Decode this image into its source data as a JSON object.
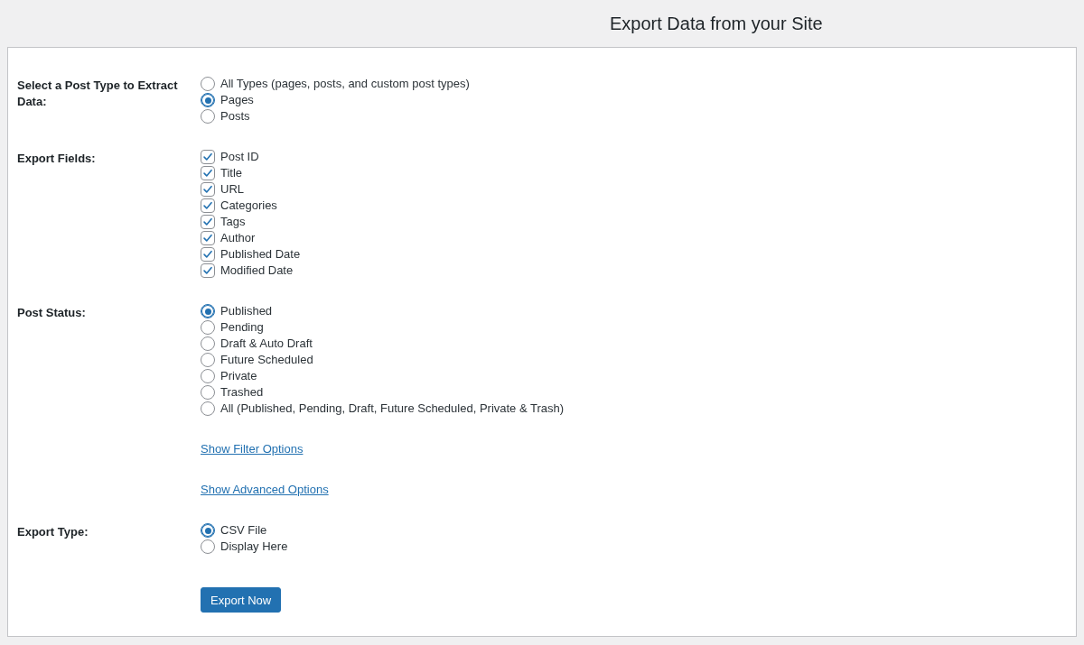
{
  "page": {
    "title": "Export Data from your Site"
  },
  "sections": [
    {
      "kind": "radio",
      "label": "Select a Post Type to Extract Data:",
      "options": [
        {
          "label": "All Types (pages, posts, and custom post types)",
          "selected": false
        },
        {
          "label": "Pages",
          "selected": true
        },
        {
          "label": "Posts",
          "selected": false
        }
      ]
    },
    {
      "kind": "checkbox",
      "label": "Export Fields:",
      "options": [
        {
          "label": "Post ID",
          "checked": true
        },
        {
          "label": "Title",
          "checked": true
        },
        {
          "label": "URL",
          "checked": true
        },
        {
          "label": "Categories",
          "checked": true
        },
        {
          "label": "Tags",
          "checked": true
        },
        {
          "label": "Author",
          "checked": true
        },
        {
          "label": "Published Date",
          "checked": true
        },
        {
          "label": "Modified Date",
          "checked": true
        }
      ]
    },
    {
      "kind": "radio",
      "label": "Post Status:",
      "options": [
        {
          "label": "Published",
          "selected": true
        },
        {
          "label": "Pending",
          "selected": false
        },
        {
          "label": "Draft & Auto Draft",
          "selected": false
        },
        {
          "label": "Future Scheduled",
          "selected": false
        },
        {
          "label": "Private",
          "selected": false
        },
        {
          "label": "Trashed",
          "selected": false
        },
        {
          "label": "All (Published, Pending, Draft, Future Scheduled, Private & Trash)",
          "selected": false
        }
      ]
    },
    {
      "kind": "link",
      "text": "Show Filter Options"
    },
    {
      "kind": "link",
      "text": "Show Advanced Options"
    },
    {
      "kind": "radio",
      "label": "Export Type:",
      "options": [
        {
          "label": "CSV File",
          "selected": true
        },
        {
          "label": "Display Here",
          "selected": false
        }
      ]
    },
    {
      "kind": "button",
      "text": "Export Now"
    }
  ]
}
